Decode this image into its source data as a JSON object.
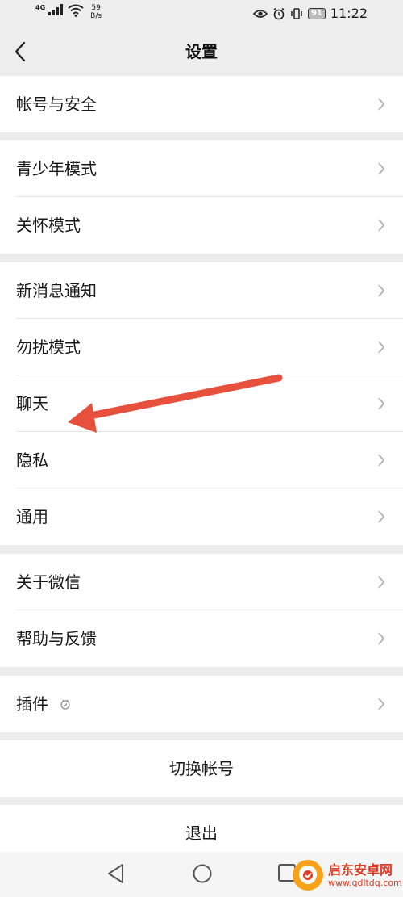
{
  "status_bar": {
    "network": "4G",
    "speed_value": "59",
    "speed_unit": "B/s",
    "battery": "91",
    "time": "11:22"
  },
  "header": {
    "title": "设置"
  },
  "groups": [
    {
      "items": [
        {
          "label": "帐号与安全"
        }
      ]
    },
    {
      "items": [
        {
          "label": "青少年模式"
        },
        {
          "label": "关怀模式"
        }
      ]
    },
    {
      "items": [
        {
          "label": "新消息通知"
        },
        {
          "label": "勿扰模式"
        },
        {
          "label": "聊天"
        },
        {
          "label": "隐私"
        },
        {
          "label": "通用"
        }
      ]
    },
    {
      "items": [
        {
          "label": "关于微信"
        },
        {
          "label": "帮助与反馈"
        }
      ]
    },
    {
      "items": [
        {
          "label": "插件"
        }
      ]
    }
  ],
  "actions": {
    "switch_account": "切换帐号",
    "logout": "退出"
  },
  "watermark": {
    "name": "启东安卓网",
    "url": "www.qdltdq.com"
  },
  "colors": {
    "background": "#ededed",
    "annotation_arrow": "#e8503e",
    "separator": "#e6e6e6"
  }
}
